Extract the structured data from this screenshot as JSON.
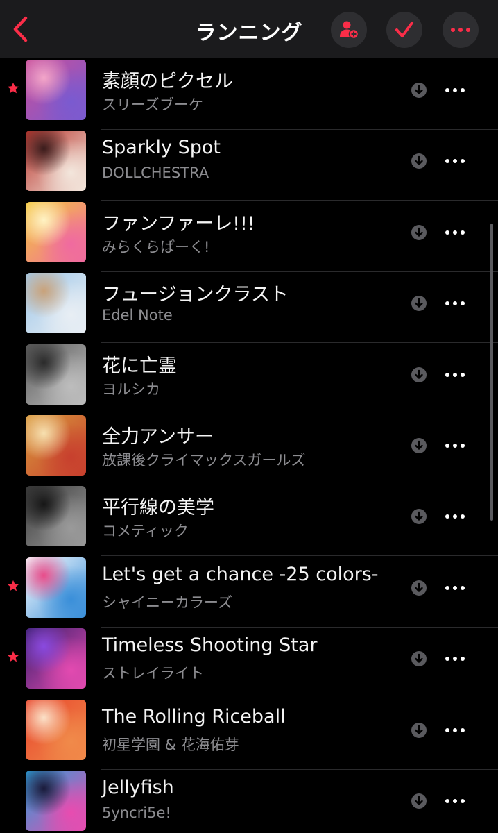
{
  "nav": {
    "title": "ランニング",
    "back_icon": "chevron-left-icon",
    "add_person_icon": "person-add-icon",
    "check_icon": "checkmark-icon",
    "more_icon": "ellipsis-icon",
    "accent": "#fa2d48"
  },
  "tracks": [
    {
      "title": "素顔のピクセル",
      "artist": "スリーズブーケ",
      "favorite": true,
      "art_colors": [
        "#c94f9a",
        "#7a5ad0",
        "#f3a6c9"
      ]
    },
    {
      "title": "Sparkly Spot",
      "artist": "DOLLCHESTRA",
      "favorite": false,
      "art_colors": [
        "#b8342c",
        "#f3e6dc",
        "#3a1c1c"
      ]
    },
    {
      "title": "ファンファーレ!!!",
      "artist": "みらくらぱーく!",
      "favorite": false,
      "art_colors": [
        "#f4c93a",
        "#f06aa0",
        "#fff3c4"
      ]
    },
    {
      "title": "フュージョンクラスト",
      "artist": "Edel Note",
      "favorite": false,
      "art_colors": [
        "#9fc7e8",
        "#e8eef4",
        "#c9a27a"
      ]
    },
    {
      "title": "花に亡霊",
      "artist": "ヨルシカ",
      "favorite": false,
      "art_colors": [
        "#5d5d5d",
        "#bdbdbd",
        "#2a2a2a"
      ]
    },
    {
      "title": "全力アンサー",
      "artist": "放課後クライマックスガールズ",
      "favorite": false,
      "art_colors": [
        "#d89a3c",
        "#c8402e",
        "#f7e0b0"
      ]
    },
    {
      "title": "平行線の美学",
      "artist": "コメティック",
      "favorite": false,
      "art_colors": [
        "#3c3c3c",
        "#9a9a9a",
        "#161616"
      ]
    },
    {
      "title": "Let's get a chance -25 colors-",
      "artist": "シャイニーカラーズ",
      "favorite": true,
      "art_colors": [
        "#ffffff",
        "#3a8fd9",
        "#e84c8a"
      ]
    },
    {
      "title": "Timeless Shooting Star",
      "artist": "ストレイライト",
      "favorite": true,
      "art_colors": [
        "#3a1f6e",
        "#e24ab0",
        "#8a4ae0"
      ]
    },
    {
      "title": "The Rolling Riceball",
      "artist": "初星学園 & 花海佑芽",
      "favorite": false,
      "art_colors": [
        "#e8452c",
        "#f08a4a",
        "#fbe1c8"
      ]
    },
    {
      "title": "Jellyfish",
      "artist": "5yncri5e!",
      "favorite": false,
      "art_colors": [
        "#2a9fd8",
        "#e84cb0",
        "#1a1a3a"
      ]
    }
  ]
}
